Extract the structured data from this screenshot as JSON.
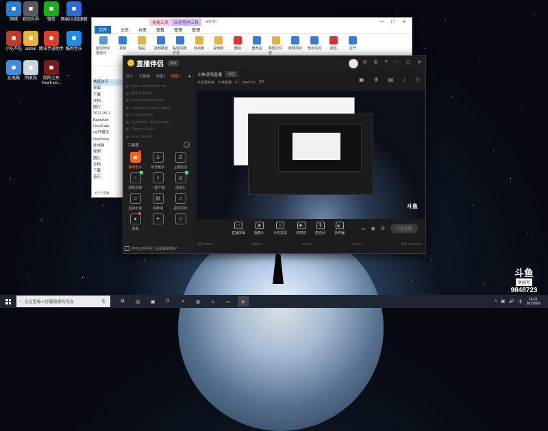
{
  "desktop": {
    "icons": [
      {
        "label": "网络",
        "icon": "network-icon",
        "color": "#2a7fd4"
      },
      {
        "label": "我的世界",
        "icon": "minecraft-icon",
        "color": "#5b5b5b"
      },
      {
        "label": "微信",
        "icon": "wechat-icon",
        "color": "#1aad19"
      },
      {
        "label": "网易UU加速器",
        "icon": "uu-booster-icon",
        "color": "#2f6bd8"
      },
      {
        "label": "小吃不吃",
        "icon": "game-icon",
        "color": "#c23a2a"
      },
      {
        "label": "admin",
        "icon": "user-folder-icon",
        "color": "#e8b339"
      },
      {
        "label": "腾讯手游助手",
        "icon": "tencent-assistant-icon",
        "color": "#e03a2a"
      },
      {
        "label": "酷狗音乐",
        "icon": "kugou-icon",
        "color": "#1f8ce8"
      },
      {
        "label": "此电脑",
        "icon": "computer-icon",
        "color": "#3a8de0"
      },
      {
        "label": "回收站",
        "icon": "recycle-bin-icon",
        "color": "#c9d4de"
      },
      {
        "label": "阴阳之形 FearFact...",
        "icon": "fear-game-icon",
        "color": "#7a1a1a"
      }
    ]
  },
  "explorer": {
    "quick_tool_tab": "快捷工具",
    "app_tool_tab": "应用程序工具",
    "title": "admin",
    "tabs": [
      "文件",
      "主页",
      "共享",
      "查看",
      "管理",
      "管理"
    ],
    "ribbon": [
      "固定到快速访问",
      "复制",
      "粘贴",
      "复制路径",
      "粘贴快捷方式",
      "移动到",
      "复制到",
      "删除",
      "重命名",
      "新建文件夹",
      "新建项目",
      "轻松访问",
      "属性",
      "打开",
      "编辑",
      "历史记录",
      "全部选择",
      "全部取消",
      "反向选择"
    ],
    "nav": [
      "快速访问",
      "桌面",
      "下载",
      "文档",
      "图片",
      "2021-05-1",
      "BaiduNet",
      "UserData",
      "ssl开播手",
      "OneDrive",
      "此电脑",
      "视频",
      "图片",
      "文档",
      "下载",
      "音乐"
    ],
    "status": "72 个项目"
  },
  "douyu": {
    "app_name": "直播伴侣",
    "version_badge": "测试",
    "left_tabs": [
      "双人",
      "可能有",
      "场景1",
      "场景2"
    ],
    "scenes": [
      "Super Scheme Memes",
      "腾讯手游助手",
      "WeaponShopFantasy",
      "zoplatforms_watch_game",
      "FearScreened",
      "Scrabbled - Early Access",
      "Rhythm Doctor",
      "Fear-Unrated"
    ],
    "tools_title": "工具箱",
    "tools": [
      {
        "label": "弹幕助手",
        "icon": "danmu-icon",
        "highlight": true,
        "tag": "dot"
      },
      {
        "label": "房管助手",
        "icon": "admin-helper-icon",
        "highlight": false,
        "tag": ""
      },
      {
        "label": "主播任务",
        "icon": "task-icon",
        "highlight": false,
        "tag": ""
      },
      {
        "label": "相机追踪",
        "icon": "camera-track-icon",
        "highlight": false,
        "tag": "新"
      },
      {
        "label": "一键下播",
        "icon": "download-icon",
        "highlight": false,
        "tag": ""
      },
      {
        "label": "摄像头",
        "icon": "camera-icon",
        "highlight": false,
        "tag": "新"
      },
      {
        "label": "虚拟形象",
        "icon": "avatar-icon",
        "highlight": false,
        "tag": ""
      },
      {
        "label": "弹幕墙",
        "icon": "danmu-wall-icon",
        "highlight": false,
        "tag": ""
      },
      {
        "label": "歌词同步",
        "icon": "lyrics-icon",
        "highlight": false,
        "tag": ""
      },
      {
        "label": "录像",
        "icon": "record-icon",
        "highlight": false,
        "tag": "dot"
      },
      {
        "label": "",
        "icon": "gift-icon",
        "highlight": false,
        "tag": ""
      },
      {
        "label": "",
        "icon": "upload-icon",
        "highlight": false,
        "tag": ""
      }
    ],
    "tip": "你可以在手机上设置弹幕镜头？",
    "room_title": "斗鱼游戏直播",
    "room_status": "分区",
    "room_sub": [
      "未设置封面",
      "大神直播",
      "ID：9848723",
      "324"
    ],
    "bottom_buttons": [
      "直播屏幕",
      "摄像头",
      "手机投屏",
      "多媒体",
      "麦克风",
      "扬声器"
    ],
    "start_label": "开始直播",
    "stats": [
      "码率 0kbps",
      "丢帧 0%",
      "FPS 60",
      "CPU 6%",
      "时长 00:00:00"
    ],
    "preview_logo": "斗鱼"
  },
  "watermark": {
    "brand": "斗鱼",
    "subtitle": "房间号",
    "room_id": "9848723"
  },
  "taskbar": {
    "search_placeholder": "在这里输入你要搜索的内容",
    "apps": [
      "task-view-icon",
      "explorer-app-icon",
      "game-app-icon",
      "g-app-icon",
      "firefox-icon",
      "chrome-icon",
      "steam-icon",
      "folder-app-icon",
      "douyu-app-icon"
    ],
    "time": "14:22",
    "date": "2021/9/3"
  }
}
